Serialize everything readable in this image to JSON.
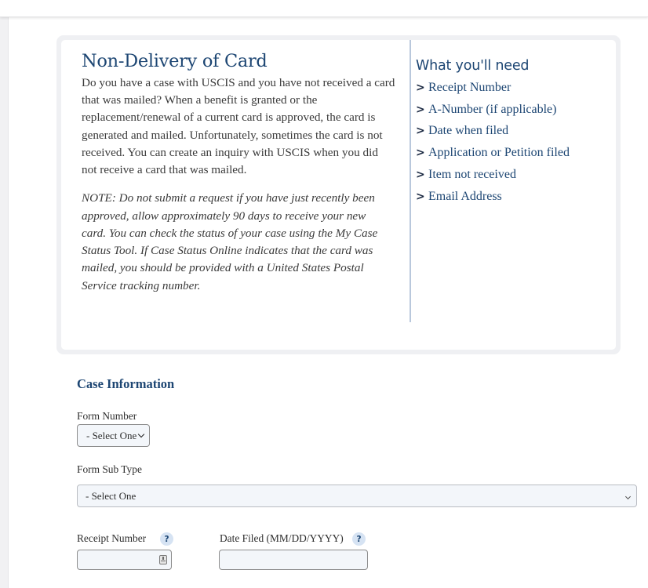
{
  "info": {
    "title": "Non-Delivery of Card",
    "body": "Do you have a case with USCIS and you have not received a card that was mailed? When a benefit is granted or the replacement/renewal of a current card is approved, the card is generated and mailed. Unfortunately, sometimes the card is not received. You can create an inquiry with USCIS when you did not receive a card that was mailed.",
    "note": "NOTE: Do not submit a request if you have just recently been approved, allow approximately 90 days to receive your new card. You can check the status of your case using the My Case Status Tool. If Case Status Online indicates that the card was mailed, you should be provided with a United States Postal Service tracking number."
  },
  "needs": {
    "title": "What you'll need",
    "bullet_glyph": ">",
    "items": [
      "Receipt Number",
      "A-Number (if applicable)",
      "Date when filed",
      "Application or Petition filed",
      "Item not received",
      "Email Address"
    ]
  },
  "form": {
    "section_title": "Case Information",
    "form_number": {
      "label": "Form Number",
      "selected": "- Select One"
    },
    "form_sub_type": {
      "label": "Form Sub Type",
      "selected": "- Select One"
    },
    "receipt_number": {
      "label": "Receipt Number",
      "value": "",
      "help_glyph": "?"
    },
    "date_filed": {
      "label": "Date Filed (MM/DD/YYYY)",
      "value": "",
      "help_glyph": "?"
    }
  }
}
